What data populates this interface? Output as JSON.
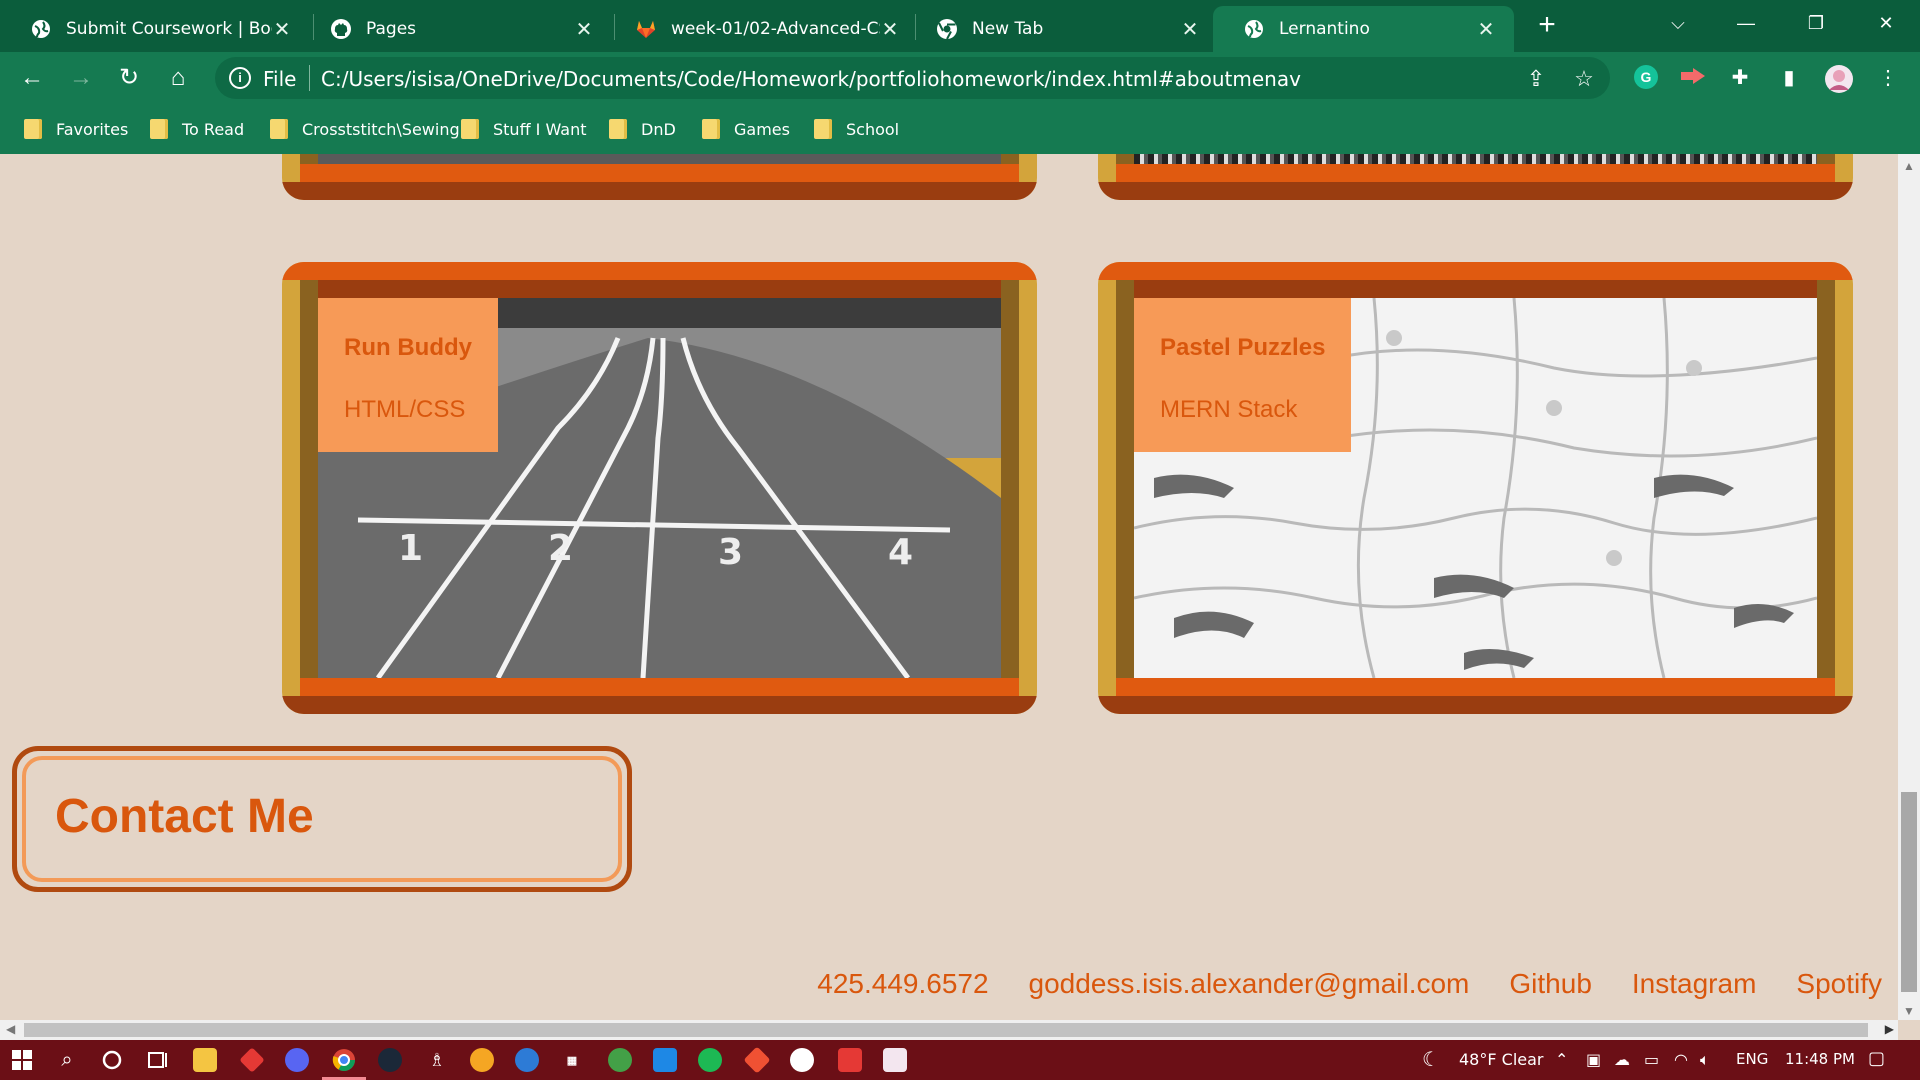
{
  "browser": {
    "tabs": [
      {
        "title": "Submit Coursework | Bootca",
        "icon": "globe-icon"
      },
      {
        "title": "Pages",
        "icon": "github-icon"
      },
      {
        "title": "week-01/02-Advanced-CSS",
        "icon": "gitlab-icon"
      },
      {
        "title": "New Tab",
        "icon": "chrome-icon"
      },
      {
        "title": "Lernantino",
        "icon": "globe-icon",
        "active": true
      }
    ],
    "omnibox": {
      "scheme_label": "File",
      "url": "C:/Users/isisa/OneDrive/Documents/Code/Homework/portfoliohomework/index.html#aboutmenav"
    },
    "bookmarks": [
      "Favorites",
      "To Read",
      "Crosststitch\\Sewing",
      "Stuff I Want",
      "DnD",
      "Games",
      "School"
    ]
  },
  "page": {
    "projects": [
      {
        "name": "Run Buddy",
        "stack": "HTML/CSS",
        "image": "running-track-photo"
      },
      {
        "name": "Pastel Puzzles",
        "stack": "MERN Stack",
        "image": "puzzle-pieces-photo"
      }
    ],
    "contact": {
      "heading": "Contact Me",
      "phone": "425.449.6572",
      "email": "goddess.isis.alexander@gmail.com",
      "github": "Github",
      "instagram": "Instagram",
      "spotify": "Spotify"
    }
  },
  "taskbar": {
    "weather": "48°F Clear",
    "language": "ENG",
    "time": "11:48 PM"
  },
  "colors": {
    "browser_chrome": "#157a51",
    "page_background": "#e4d5c7",
    "accent_orange": "#d9570d",
    "frame_gold": "#d3a43b",
    "label_background": "#f79a57",
    "taskbar": "#6b0f16"
  }
}
